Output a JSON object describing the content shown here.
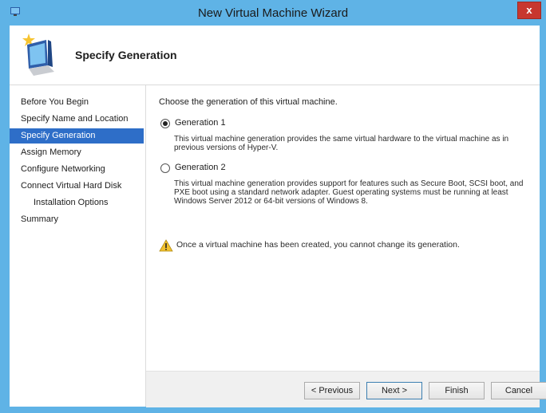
{
  "window": {
    "title": "New Virtual Machine Wizard",
    "close_label": "x"
  },
  "header": {
    "title": "Specify Generation",
    "icon": "wizard-computer-icon"
  },
  "nav": {
    "items": [
      {
        "label": "Before You Begin"
      },
      {
        "label": "Specify Name and Location"
      },
      {
        "label": "Specify Generation",
        "active": true
      },
      {
        "label": "Assign Memory"
      },
      {
        "label": "Configure Networking"
      },
      {
        "label": "Connect Virtual Hard Disk"
      },
      {
        "label": "Installation Options",
        "sub": true
      },
      {
        "label": "Summary"
      }
    ]
  },
  "content": {
    "prompt": "Choose the generation of this virtual machine.",
    "options": [
      {
        "label": "Generation 1",
        "selected": true,
        "description": "This virtual machine generation provides the same virtual hardware to the virtual machine as in previous versions of Hyper-V."
      },
      {
        "label": "Generation 2",
        "selected": false,
        "description": "This virtual machine generation provides support for features such as Secure Boot, SCSI boot, and PXE boot using a standard network adapter. Guest operating systems must be running at least Windows Server 2012 or 64-bit versions of Windows 8."
      }
    ],
    "warning": "Once a virtual machine has been created, you cannot change its generation."
  },
  "footer": {
    "previous_label": "< Previous",
    "next_label": "Next >",
    "finish_label": "Finish",
    "cancel_label": "Cancel"
  },
  "colors": {
    "title_bar": "#5fb3e6",
    "nav_selected": "#2e6ec8",
    "close_button": "#c7372f"
  }
}
